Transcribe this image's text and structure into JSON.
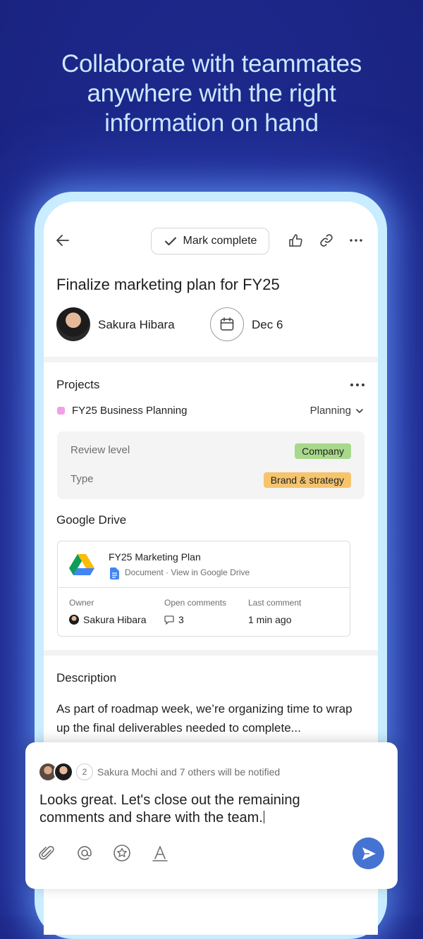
{
  "headline": {
    "line1": "Collaborate with teammates",
    "line2": "anywhere with the right",
    "line3": "information on hand"
  },
  "toolbar": {
    "mark_complete_label": "Mark complete",
    "icons": [
      "back-arrow-icon",
      "check-icon",
      "thumbs-up-icon",
      "link-icon",
      "more-icon"
    ]
  },
  "task": {
    "title": "Finalize marketing plan for FY25",
    "assignee": "Sakura Hibara",
    "due_date": "Dec 6"
  },
  "projects": {
    "heading": "Projects",
    "project_name": "FY25 Business Planning",
    "project_color": "#f59ee6",
    "section": "Planning",
    "fields": [
      {
        "label": "Review level",
        "value": "Company",
        "color": "#a8d98a"
      },
      {
        "label": "Type",
        "value": "Brand & strategy",
        "color": "#f5c46d"
      }
    ]
  },
  "google_drive": {
    "heading": "Google Drive",
    "file_title": "FY25 Marketing Plan",
    "file_subtitle": "Document · View in Google Drive",
    "owner_label": "Owner",
    "owner_value": "Sakura Hibara",
    "comments_label": "Open comments",
    "comments_value": "3",
    "last_comment_label": "Last comment",
    "last_comment_value": "1 min ago"
  },
  "description": {
    "heading": "Description",
    "text": "As part of roadmap week, we’re organizing time to wrap up the final deliverables needed to complete..."
  },
  "composer": {
    "collaborator_count": "2",
    "notify_text": "Sakura Mochi and 7 others will be notified",
    "comment_text": "Looks great. Let's close out the remaining comments and share with the team.",
    "tools": [
      "attach-icon",
      "mention-icon",
      "star-icon",
      "text-format-icon",
      "send-icon"
    ],
    "send_color": "#4573d2"
  }
}
